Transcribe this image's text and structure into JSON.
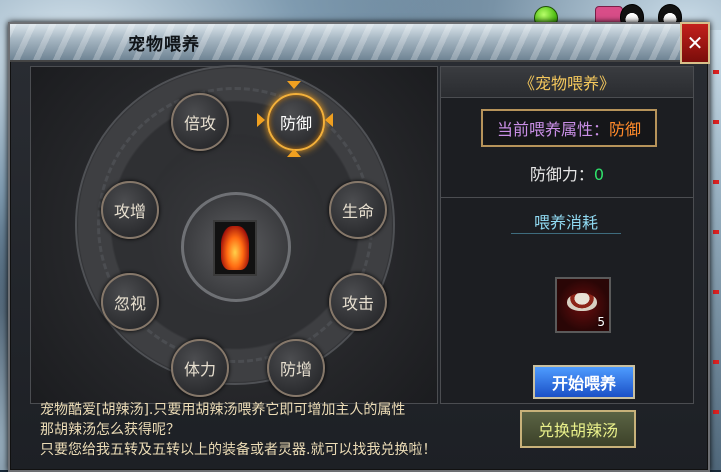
{
  "window": {
    "title": "宠物喂养",
    "close_label": "✕"
  },
  "wheel": {
    "nodes": {
      "beigong": "倍攻",
      "fangyu": "防御",
      "gongzeng": "攻增",
      "shengming": "生命",
      "hushi": "忽视",
      "gongji": "攻击",
      "tili": "体力",
      "fangzeng": "防增"
    },
    "selected": "防御"
  },
  "info": {
    "header": "《宠物喂养》",
    "attr_label": "当前喂养属性：",
    "attr_value": "防御",
    "def_label": "防御力：",
    "def_value": "0",
    "cost_title": "喂养消耗",
    "item_count": "5",
    "start_button": "开始喂养"
  },
  "description": {
    "line1": "宠物酷爱[胡辣汤].只要用胡辣汤喂养它即可增加主人的属性",
    "line2": "那胡辣汤怎么获得呢？",
    "line3": "只要您给我五转及五转以上的装备或者灵器.就可以找我兑换啦！"
  },
  "exchange_button": "兑换胡辣汤",
  "colors": {
    "accent_gold": "#f3c75c",
    "attr_purple": "#c98fe6",
    "attr_orange": "#ff8a2a",
    "value_green": "#2ee06a",
    "cost_cyan": "#8fd8f0"
  }
}
